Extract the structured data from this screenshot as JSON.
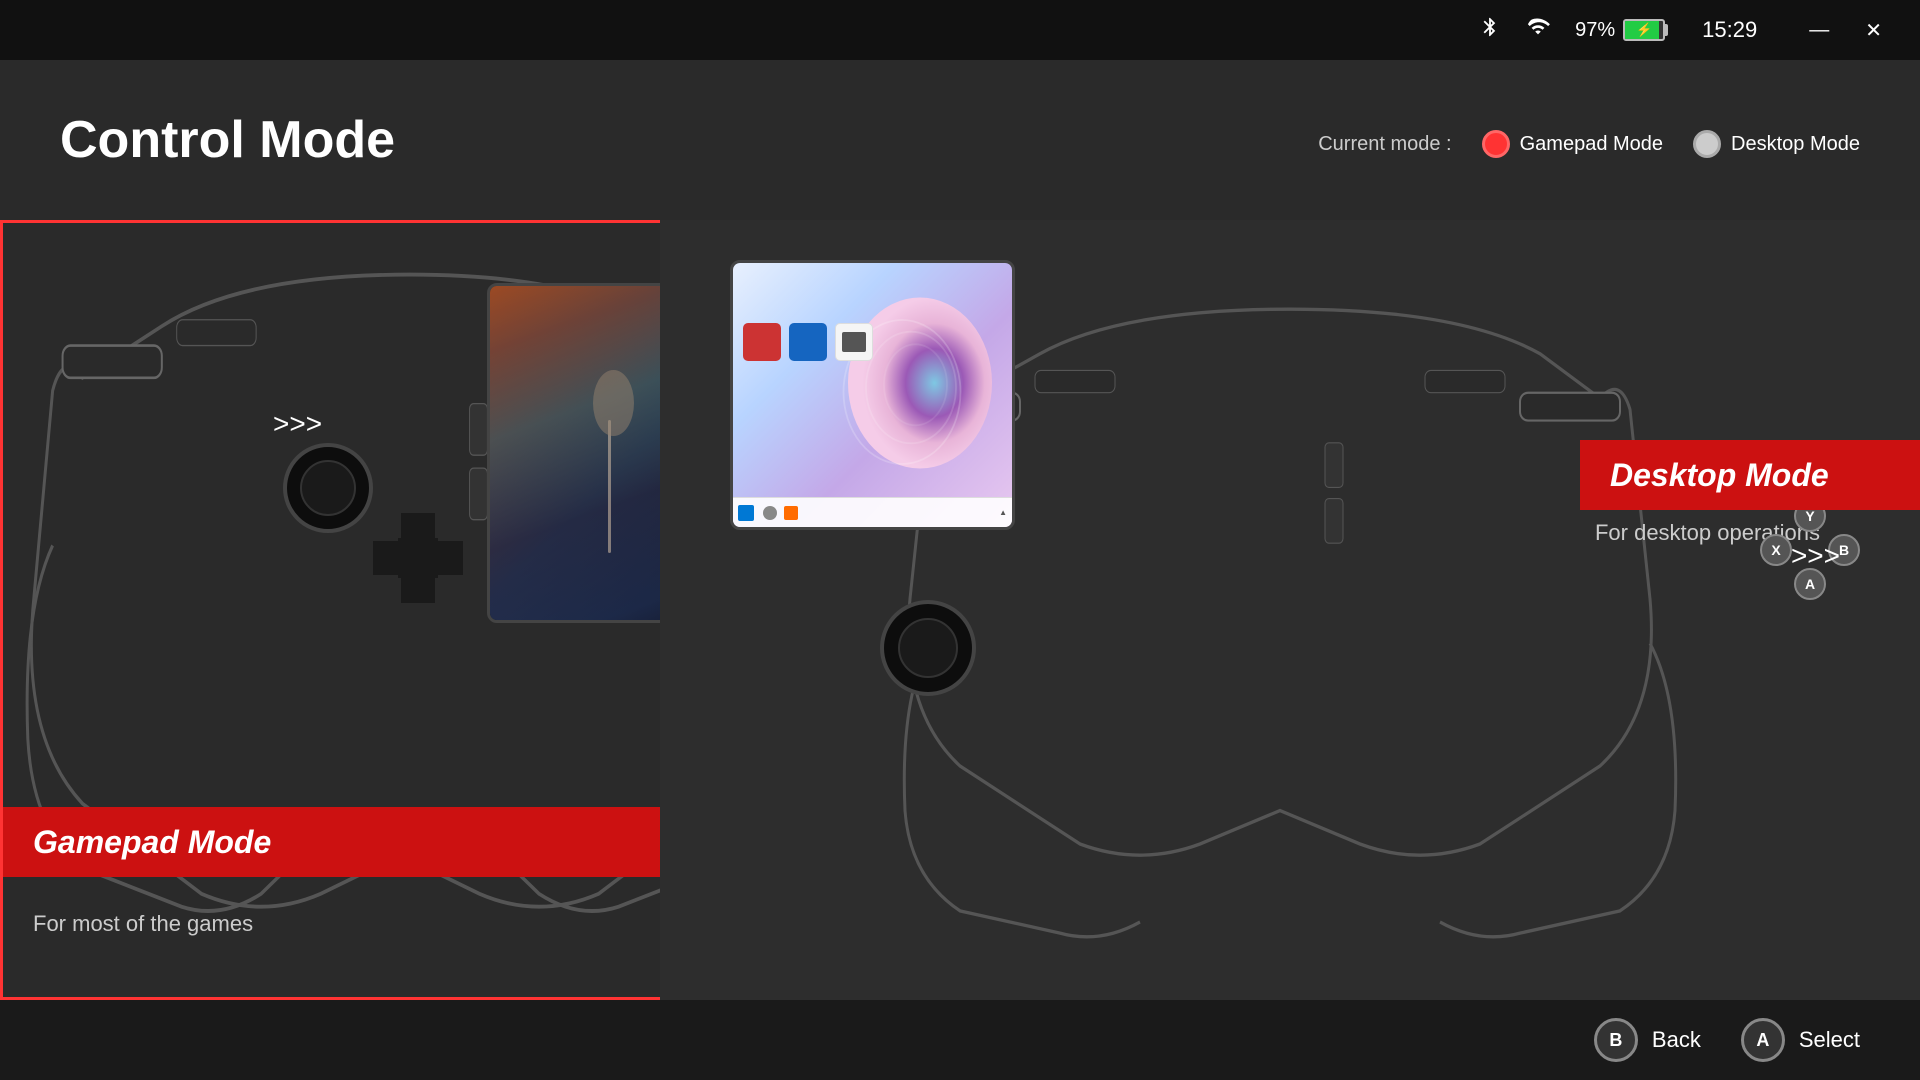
{
  "titlebar": {
    "bluetooth_icon": "✱",
    "wifi_icon": "📶",
    "battery_percent": "97%",
    "time": "15:29",
    "minimize_label": "—",
    "close_label": "✕"
  },
  "header": {
    "title": "Control Mode",
    "current_mode_label": "Current mode :",
    "gamepad_mode_label": "Gamepad Mode",
    "desktop_mode_label": "Desktop Mode"
  },
  "gamepad_card": {
    "title": "Gamepad Mode",
    "subtitle": "For most of the games",
    "arrows": ">>>",
    "active": true
  },
  "desktop_card": {
    "title": "Desktop Mode",
    "for_ops_text": "For desktop operations",
    "arrows": ">>>",
    "active": false
  },
  "bottom_bar": {
    "back_btn_label": "B",
    "back_label": "Back",
    "select_btn_label": "A",
    "select_label": "Select"
  },
  "abxy_buttons": {
    "y": "Y",
    "x": "X",
    "b": "B",
    "a": "A"
  }
}
